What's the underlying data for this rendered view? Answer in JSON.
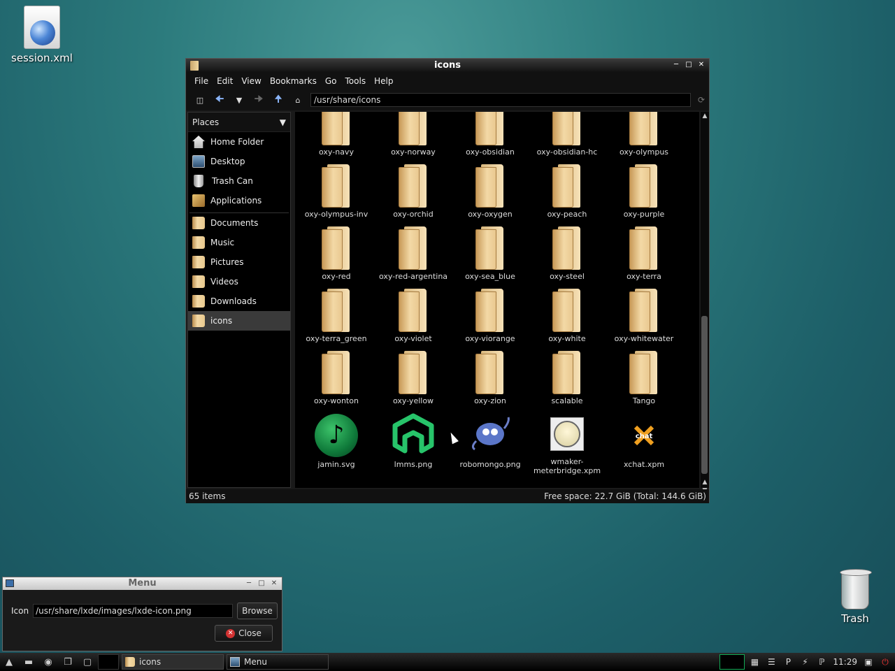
{
  "desktop": {
    "session_label": "session.xml",
    "trash_label": "Trash"
  },
  "fm": {
    "title": "icons",
    "menu": [
      "File",
      "Edit",
      "View",
      "Bookmarks",
      "Go",
      "Tools",
      "Help"
    ],
    "path": "/usr/share/icons",
    "places_header": "Places",
    "places": [
      {
        "label": "Home Folder",
        "icon": "home-icon"
      },
      {
        "label": "Desktop",
        "icon": "desktop-icon"
      },
      {
        "label": "Trash Can",
        "icon": "trash-icon"
      },
      {
        "label": "Applications",
        "icon": "applications-icon"
      }
    ],
    "bookmarks": [
      {
        "label": "Documents",
        "icon": "folder-icon"
      },
      {
        "label": "Music",
        "icon": "folder-icon"
      },
      {
        "label": "Pictures",
        "icon": "folder-icon"
      },
      {
        "label": "Videos",
        "icon": "folder-icon"
      },
      {
        "label": "Downloads",
        "icon": "folder-icon"
      },
      {
        "label": "icons",
        "icon": "folder-icon",
        "selected": true
      }
    ],
    "items": [
      {
        "label": "oxy-navy",
        "kind": "folder"
      },
      {
        "label": "oxy-norway",
        "kind": "folder"
      },
      {
        "label": "oxy-obsidian",
        "kind": "folder"
      },
      {
        "label": "oxy-obsidian-hc",
        "kind": "folder"
      },
      {
        "label": "oxy-olympus",
        "kind": "folder"
      },
      {
        "label": "oxy-olympus-inv",
        "kind": "folder"
      },
      {
        "label": "oxy-orchid",
        "kind": "folder"
      },
      {
        "label": "oxy-oxygen",
        "kind": "folder"
      },
      {
        "label": "oxy-peach",
        "kind": "folder"
      },
      {
        "label": "oxy-purple",
        "kind": "folder"
      },
      {
        "label": "oxy-red",
        "kind": "folder"
      },
      {
        "label": "oxy-red-argentina",
        "kind": "folder"
      },
      {
        "label": "oxy-sea_blue",
        "kind": "folder"
      },
      {
        "label": "oxy-steel",
        "kind": "folder"
      },
      {
        "label": "oxy-terra",
        "kind": "folder"
      },
      {
        "label": "oxy-terra_green",
        "kind": "folder"
      },
      {
        "label": "oxy-violet",
        "kind": "folder"
      },
      {
        "label": "oxy-viorange",
        "kind": "folder"
      },
      {
        "label": "oxy-white",
        "kind": "folder"
      },
      {
        "label": "oxy-whitewater",
        "kind": "folder"
      },
      {
        "label": "oxy-wonton",
        "kind": "folder"
      },
      {
        "label": "oxy-yellow",
        "kind": "folder"
      },
      {
        "label": "oxy-zion",
        "kind": "folder"
      },
      {
        "label": "scalable",
        "kind": "folder"
      },
      {
        "label": "Tango",
        "kind": "folder"
      },
      {
        "label": "jamin.svg",
        "kind": "jamin"
      },
      {
        "label": "lmms.png",
        "kind": "lmms"
      },
      {
        "label": "robomongo.png",
        "kind": "robomongo"
      },
      {
        "label": "wmaker-meterbridge.xpm",
        "kind": "wmaker"
      },
      {
        "label": "xchat.xpm",
        "kind": "xchat"
      }
    ],
    "status_left": "65 items",
    "status_right": "Free space: 22.7 GiB (Total: 144.6 GiB)"
  },
  "dialog": {
    "title": "Menu",
    "icon_label": "Icon",
    "icon_value": "/usr/share/lxde/images/lxde-icon.png",
    "browse_label": "Browse",
    "close_label": "Close"
  },
  "taskbar": {
    "tasks": [
      {
        "label": "icons",
        "icon": "folder-icon",
        "active": true
      },
      {
        "label": "Menu",
        "icon": "window-icon",
        "active": false
      }
    ],
    "clock": "11:29"
  }
}
